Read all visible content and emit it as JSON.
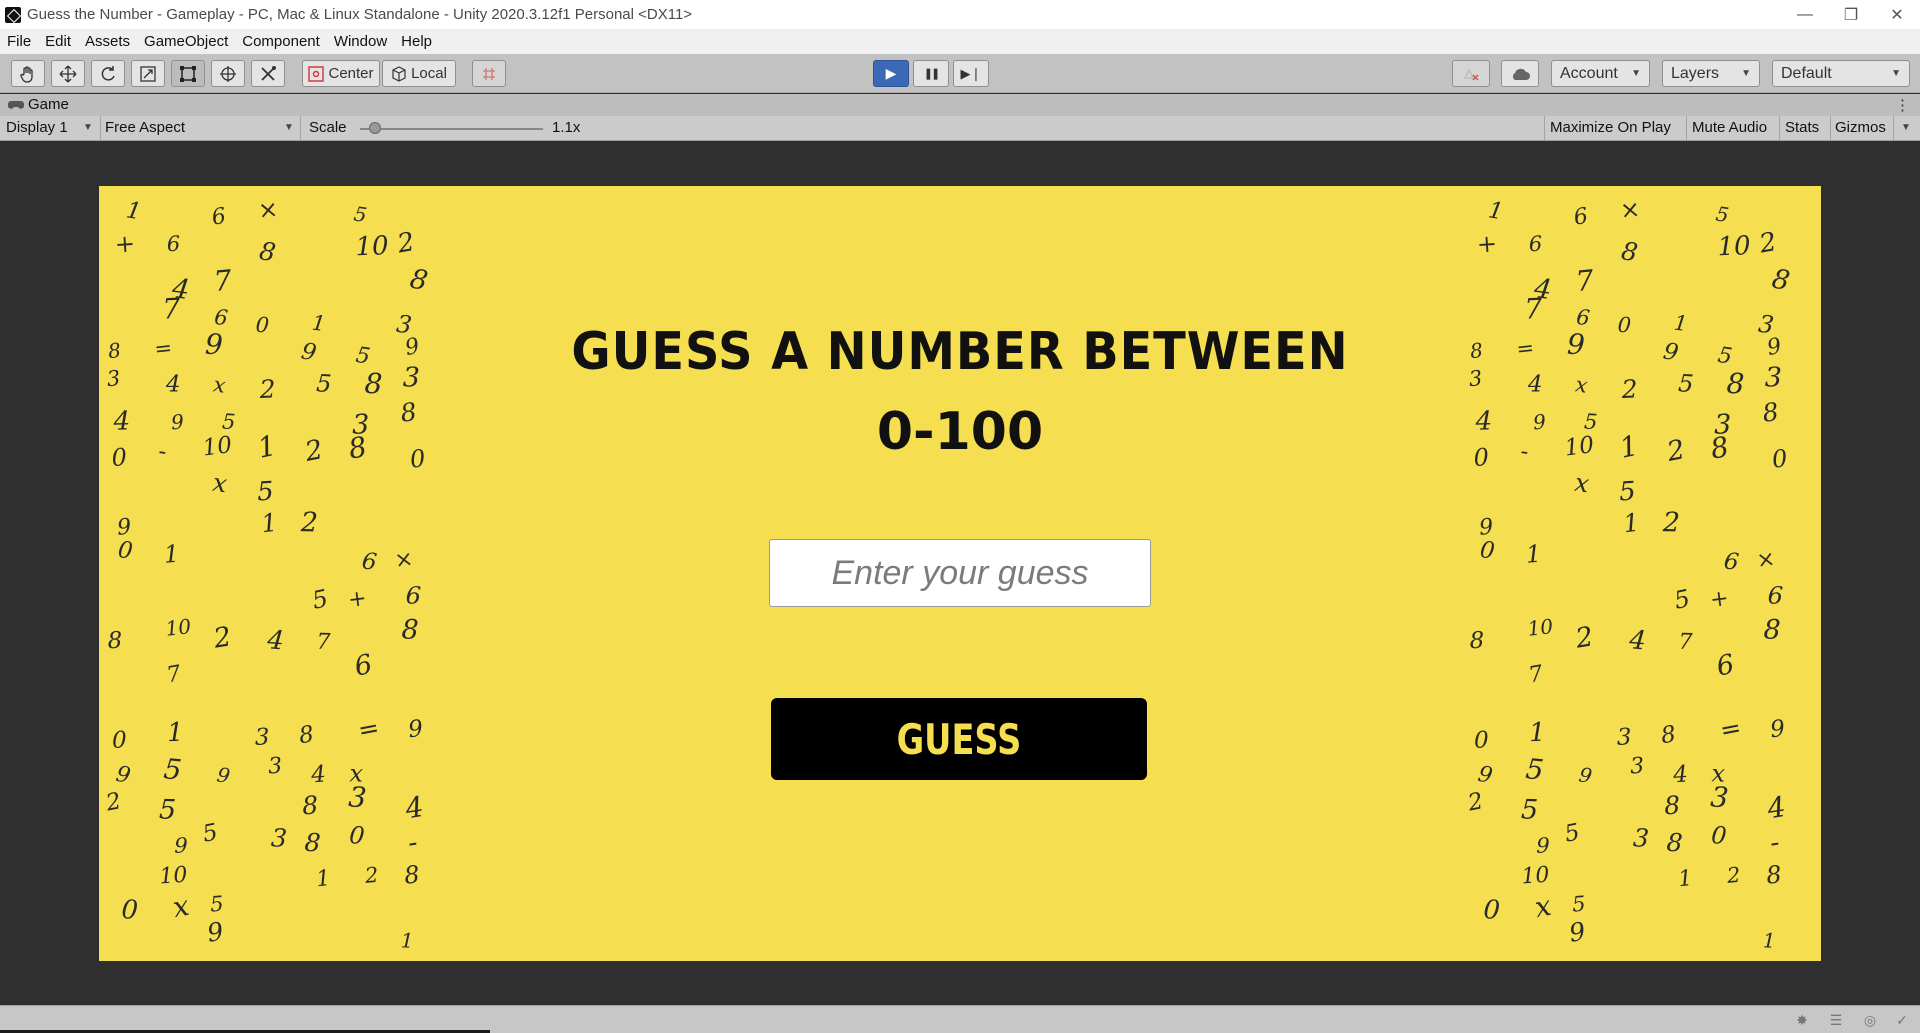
{
  "window": {
    "title": "Guess the Number - Gameplay - PC, Mac & Linux Standalone - Unity 2020.3.12f1 Personal <DX11>",
    "controls": {
      "minimize": "—",
      "restore": "❐",
      "close": "✕"
    }
  },
  "menu": [
    "File",
    "Edit",
    "Assets",
    "GameObject",
    "Component",
    "Window",
    "Help"
  ],
  "toolbar": {
    "tools": [
      "hand-tool",
      "move-tool",
      "rotate-tool",
      "scale-tool",
      "rect-tool",
      "transform-tool",
      "custom-tool"
    ],
    "pivot_label": "Center",
    "space_label": "Local",
    "play": "▶",
    "pause": "❚❚",
    "step": "▶❘",
    "account_label": "Account",
    "layers_label": "Layers",
    "layout_label": "Default"
  },
  "game_tab": {
    "label": "Game",
    "kebab": "⋮"
  },
  "game_bar": {
    "display": "Display 1",
    "aspect": "Free Aspect",
    "scale_label": "Scale",
    "scale_value": "1.1x",
    "scale_fraction": 0.08,
    "maximize_on_play": "Maximize On Play",
    "mute_audio": "Mute Audio",
    "stats": "Stats",
    "gizmos": "Gizmos"
  },
  "game": {
    "background_color": "#f5de4f",
    "heading_line1": "GUESS A NUMBER BETWEEN",
    "heading_line2": "0-100",
    "input_placeholder": "Enter your guess",
    "button_label": "GUESS"
  },
  "colors": {
    "accent_play": "#3b69b5",
    "game_yellow": "#f5de4f",
    "button_black": "#000000"
  }
}
